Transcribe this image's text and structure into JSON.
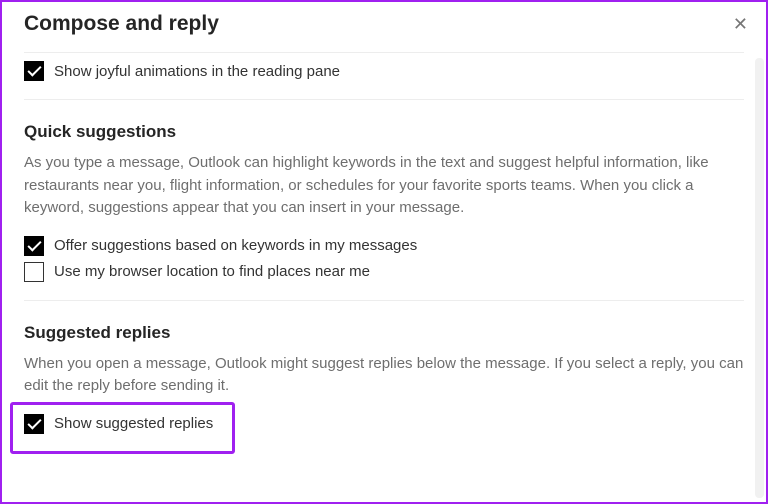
{
  "panel": {
    "title": "Compose and reply"
  },
  "joyful": {
    "label": "Show joyful animations in the reading pane",
    "checked": true
  },
  "quick": {
    "title": "Quick suggestions",
    "desc": "As you type a message, Outlook can highlight keywords in the text and suggest helpful information, like restaurants near you, flight information, or schedules for your favorite sports teams. When you click a keyword, suggestions appear that you can insert in your message.",
    "optA": {
      "label": "Offer suggestions based on keywords in my messages",
      "checked": true
    },
    "optB": {
      "label": "Use my browser location to find places near me",
      "checked": false
    }
  },
  "suggested": {
    "title": "Suggested replies",
    "desc": "When you open a message, Outlook might suggest replies below the message. If you select a reply, you can edit the reply before sending it.",
    "opt": {
      "label": "Show suggested replies",
      "checked": true
    }
  }
}
